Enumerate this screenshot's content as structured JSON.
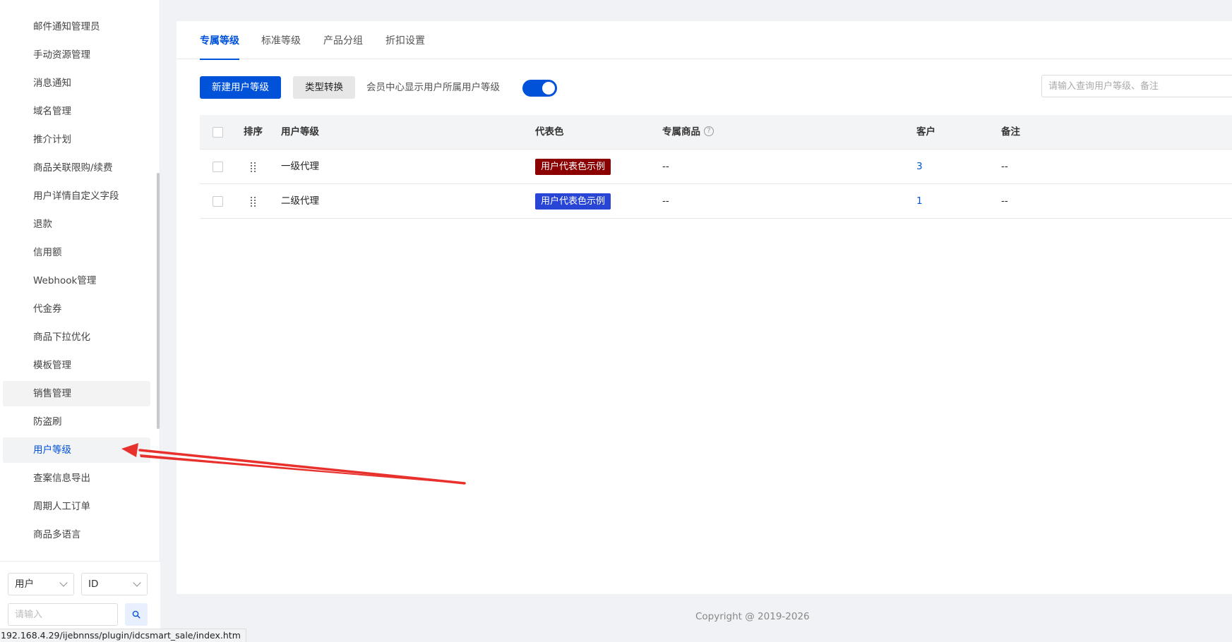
{
  "sidebar": {
    "items": [
      {
        "label": "邮件通知管理员"
      },
      {
        "label": "手动资源管理"
      },
      {
        "label": "消息通知"
      },
      {
        "label": "域名管理"
      },
      {
        "label": "推介计划"
      },
      {
        "label": "商品关联限购/续费"
      },
      {
        "label": "用户详情自定义字段"
      },
      {
        "label": "退款"
      },
      {
        "label": "信用额"
      },
      {
        "label": "Webhook管理"
      },
      {
        "label": "代金券"
      },
      {
        "label": "商品下拉优化"
      },
      {
        "label": "模板管理"
      },
      {
        "label": "销售管理"
      },
      {
        "label": "防盗刷"
      },
      {
        "label": "用户等级"
      },
      {
        "label": "查案信息导出"
      },
      {
        "label": "周期人工订单"
      },
      {
        "label": "商品多语言"
      }
    ],
    "footer": {
      "select1_value": "用户",
      "select2_value": "ID",
      "search_placeholder": "请输入"
    }
  },
  "status_url": "192.168.4.29/ijebnnss/plugin/idcsmart_sale/index.htm",
  "tabs": [
    {
      "label": "专属等级"
    },
    {
      "label": "标准等级"
    },
    {
      "label": "产品分组"
    },
    {
      "label": "折扣设置"
    }
  ],
  "toolbar": {
    "new_button": "新建用户等级",
    "convert_button": "类型转换",
    "toggle_label": "会员中心显示用户所属用户等级",
    "toggle_on": true,
    "search_placeholder": "请输入查询用户等级、备注"
  },
  "table": {
    "headers": {
      "sort": "排序",
      "level": "用户等级",
      "color": "代表色",
      "products": "专属商品",
      "customers": "客户",
      "remark": "备注"
    },
    "rows": [
      {
        "level": "一级代理",
        "color_label": "用户代表色示例",
        "color": "#8b0000",
        "products": "--",
        "customers": "3",
        "remark": "--"
      },
      {
        "level": "二级代理",
        "color_label": "用户代表色示例",
        "color": "#2845d6",
        "products": "--",
        "customers": "1",
        "remark": "--"
      }
    ]
  },
  "copyright": "Copyright @ 2019-2026",
  "colors": {
    "accent": "#0052d9",
    "annotation_arrow": "#e8312c"
  }
}
